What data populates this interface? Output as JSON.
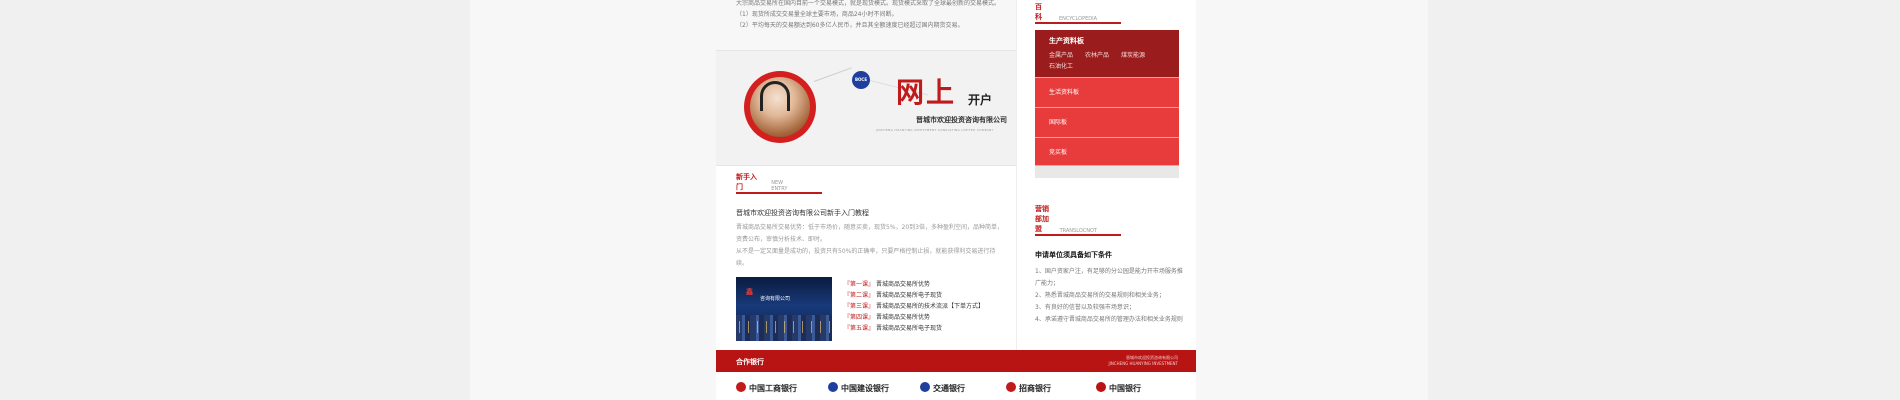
{
  "intro": {
    "lines": [
      "大宗商品交易所在国内目前一个交易模式，就是现货模式。现货模式采取了全球最创新的交易模式。",
      "（1）现货所成交交易量全球主要市场，商品24小时不间断。",
      "（2）平均每天的交易额达到60多亿人民币，并且其全额速度已经超过国内期货交易。"
    ]
  },
  "banner": {
    "title": "网上",
    "subtitle": "开户",
    "badge": "BOCE",
    "company": "晋城市欢迎投资咨询有限公司",
    "company_en": "JINCHENG HUANYING INVESTMENT CONSULTING LIMITED COMPANY"
  },
  "newbie": {
    "title_cn": "新手入门",
    "title_en": "NEW ENTRY",
    "headline": "晋城市欢迎投资咨询有限公司新手入门教程",
    "paragraphs": [
      "晋城商品交易所交易优势：低于市场价，随意买卖，现货5%，20到3倍，多种盈利空间，品种简单，资费公布，审慎分析技术、即时。",
      "从不是一定又面量是成功的，投资只有50%的正确率，只要严格控制止损，就能获得利交易进行持续。"
    ],
    "thumb_logo": "鑫",
    "thumb_label": "咨询有限公司",
    "chapters": [
      {
        "no": "『第一课』",
        "text": "晋城商品交易所优势"
      },
      {
        "no": "『第二课』",
        "text": "晋城商品交易所电子现货"
      },
      {
        "no": "『第三课』",
        "text": "晋城商品交易所的技术流派【下单方式】"
      },
      {
        "no": "『第四课』",
        "text": "晋城商品交易所优势"
      },
      {
        "no": "『第五课』",
        "text": "晋城商品交易所电子现货"
      }
    ]
  },
  "products": {
    "title_cn": "品种百科",
    "title_en": "ENCYCLOPEDIA",
    "boards": [
      {
        "label": "生产资料板",
        "sub": [
          "金属产品",
          "农林产品",
          "煤炭能源",
          "石油化工"
        ]
      },
      {
        "label": "生活资料板"
      },
      {
        "label": "国际板"
      },
      {
        "label": "竞买板"
      }
    ]
  },
  "join": {
    "title_cn": "营销部加盟",
    "title_en": "TRANSLOCNOT",
    "heading": "申请单位须具备如下条件",
    "items": [
      "1、国户资家户注，有足够的分公园是能力开市场服务推广能力；",
      "2、熟悉晋城商品交易所的交易规则和相关业务；",
      "3、有良好的信誉以及较强市场意识；",
      "4、承诺遵守晋城商品交易所的管理办法和相关业务规则"
    ]
  },
  "partners": {
    "title": "合作银行",
    "note_line1": "晋城市欢迎投资咨询有限公司",
    "note_line2": "JINCHENG HUANYING INVESTMENT",
    "banks": [
      "中国工商银行",
      "中国建设银行",
      "交通银行",
      "招商银行",
      "中国银行"
    ],
    "bank_colors": [
      "#c11a1a",
      "#1f3f9f",
      "#1f3f9f",
      "#c11a1a",
      "#b81414"
    ]
  }
}
